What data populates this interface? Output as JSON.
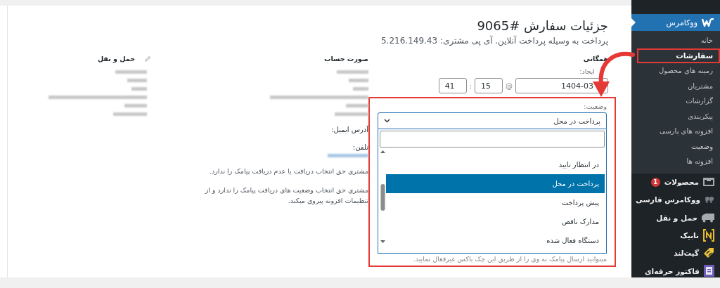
{
  "sidebar": {
    "menu_header": {
      "label": "ووکامرس",
      "kind": "woo",
      "selected": true
    },
    "submenu": [
      {
        "label": "خانه",
        "selected": false,
        "highlighted": false
      },
      {
        "label": "سفارشات",
        "selected": true,
        "highlighted": true
      },
      {
        "label": "زمینه های محصول",
        "selected": false,
        "highlighted": false
      },
      {
        "label": "مشتریان",
        "selected": false,
        "highlighted": false
      },
      {
        "label": "گزارشات",
        "selected": false,
        "highlighted": false
      },
      {
        "label": "پیکربندی",
        "selected": false,
        "highlighted": false
      },
      {
        "label": "افزونه های پارسی",
        "selected": false,
        "highlighted": false
      },
      {
        "label": "وضعیت",
        "selected": false,
        "highlighted": false
      },
      {
        "label": "افزونه ها",
        "selected": false,
        "highlighted": false
      }
    ],
    "items": [
      {
        "label": "محصولات",
        "kind": "tray",
        "badge": "1"
      },
      {
        "label": "ووکامرس فارسی",
        "kind": "quote"
      },
      {
        "label": "حمل و نقل",
        "kind": "truck"
      },
      {
        "label": "نابیک",
        "kind": "emblem"
      },
      {
        "label": "گیت‌لند",
        "kind": "tag"
      },
      {
        "label": "فاکتور حرفه‌ای",
        "kind": "invoice"
      }
    ]
  },
  "order": {
    "title": "جزئیات سفارش #9065",
    "subtitle": "پرداخت به وسیله پرداخت آنلاین. آی پی مشتری: 5.216.149.43",
    "general": {
      "heading": "همگانی",
      "date_label": "ایجاد:",
      "date": "1404-03",
      "at": "@",
      "hour": "15",
      "separator": ":",
      "minute": "41",
      "status": {
        "label": "وضعیت:",
        "value": "پرداخت در محل",
        "highlighted": true,
        "expanded": true,
        "options": [
          {
            "label": "در انتظار تایید",
            "selected": false
          },
          {
            "label": "پرداخت در محل",
            "selected": true
          },
          {
            "label": "پیش پرداخت",
            "selected": false
          },
          {
            "label": "مدارک ناقص",
            "selected": false
          },
          {
            "label": "دستگاه فعال شده",
            "selected": false
          }
        ],
        "note": "میتوانید ارسال پیامک به وی را از طریق این چک باکس غیرفعال نمایید."
      }
    },
    "billing": {
      "heading": "صورت حساب",
      "email_label": "آدرس ایمیل:",
      "phone_label": "تلفن:",
      "notes": [
        "مشتری حق انتخاب دریافت یا عدم دریافت پیامک را ندارد.",
        "مشتری حق انتخاب وضعیت های دریافت پیامک را ندارد و از تنظیمات افزونه پیروی میکند."
      ]
    },
    "shipping": {
      "heading": "حمل و نقل"
    }
  }
}
